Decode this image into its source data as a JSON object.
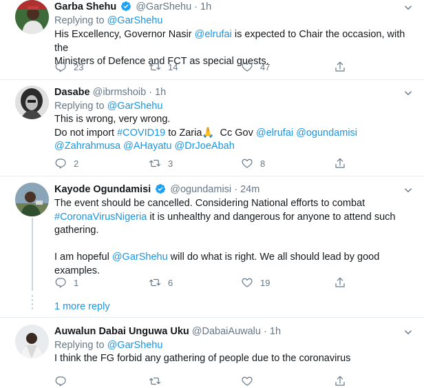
{
  "tweets": [
    {
      "name": "Garba Shehu",
      "verified": true,
      "handle": "@GarShehu",
      "dot": "·",
      "time": "1h",
      "replying_label": "Replying to ",
      "replying_handle": "@GarShehu",
      "line1_pre": "His Excellency, Governor Nasir ",
      "line1_link": "@elrufai",
      "line1_post": " is expected to Chair the occasion, with the",
      "line2": "Ministers of Defence and FCT as special guests.",
      "replies": "23",
      "retweets": "14",
      "likes": "47"
    },
    {
      "name": "Dasabe",
      "handle": "@ibrmshoib",
      "dot": "·",
      "time": "1h",
      "replying_label": "Replying to ",
      "replying_handle": "@GarShehu",
      "line1": "This is wrong, very wrong.",
      "line2_pre": "Do not import ",
      "line2_hashtag": "#COVID19",
      "line2_mid": " to Zaria",
      "line2_emoji": "🙏",
      "line2_cc": "  Cc Gov ",
      "line2_link1": "@elrufai",
      "line2_link2": "@ogundamisi",
      "line3_link1": "@Zahrahmusa",
      "line3_link2": "@AHayatu",
      "line3_link3": "@DrJoeAbah",
      "replies": "2",
      "retweets": "3",
      "likes": "8"
    },
    {
      "name": "Kayode Ogundamisi",
      "verified": true,
      "handle": "@ogundamisi",
      "dot": "·",
      "time": "24m",
      "line1": "The event should be cancelled. Considering National efforts to combat",
      "line2_hashtag": "#CoronaVirusNigeria",
      "line2_post": " it is unhealthy and dangerous for anyone to attend such",
      "line3": "gathering.",
      "line5_pre": "I am hopeful ",
      "line5_link": "@GarShehu",
      "line5_post": " will do what is right. We all should lead by good",
      "line6": "examples.",
      "replies": "1",
      "retweets": "6",
      "likes": "19"
    },
    {
      "name": "Auwalun Dabai Unguwa Uku",
      "handle": "@DabaiAuwalu",
      "dot": "·",
      "time": "1h",
      "replying_label": "Replying to ",
      "replying_handle": "@GarShehu",
      "line1": "I think the FG forbid any gathering of people due to the coronavirus"
    }
  ],
  "more_reply": "1 more reply",
  "icons": {
    "reply": "reply-icon",
    "retweet": "retweet-icon",
    "like": "heart-icon",
    "share": "share-icon",
    "caret": "chevron-down-icon",
    "verified": "verified-badge-icon"
  },
  "colors": {
    "link": "#1b95e0",
    "muted": "#657786",
    "verified": "#1da1f2"
  }
}
